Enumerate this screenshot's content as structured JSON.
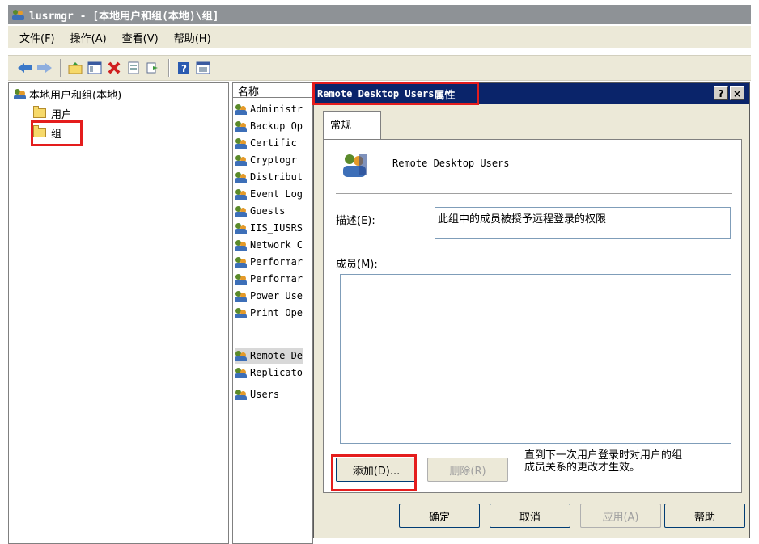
{
  "window": {
    "title": "lusrmgr - [本地用户和组(本地)\\组]",
    "menus": [
      "文件(F)",
      "操作(A)",
      "查看(V)",
      "帮助(H)"
    ],
    "toolbar_icons": [
      "back-icon",
      "forward-icon",
      "up-folder-icon",
      "show-hide-tree-icon",
      "delete-icon",
      "properties-icon",
      "export-icon",
      "help-icon",
      "view-icon"
    ]
  },
  "tree": {
    "root": "本地用户和组(本地)",
    "children": [
      "用户",
      "组"
    ]
  },
  "list": {
    "header": "名称",
    "rows": [
      "Administr",
      "Backup Op",
      "Certific",
      "Cryptogr",
      "Distribut",
      "Event Log",
      "Guests",
      "IIS_IUSRS",
      "Network C",
      "Performar",
      "Performar",
      "Power Use",
      "Print Ope",
      "Remote De",
      "Replicato",
      "Users"
    ]
  },
  "dialog": {
    "title_name": "Remote Desktop Users",
    "title_suffix": " 属性",
    "help_btn": "?",
    "close_btn": "×",
    "tab": "常规",
    "group_name": "Remote Desktop Users",
    "desc_label": "描述(E):",
    "desc_value": "此组中的成员被授予远程登录的权限",
    "members_label": "成员(M):",
    "add_btn": "添加(D)...",
    "remove_btn": "删除(R)",
    "note_line1": "直到下一次用户登录时对用户的组",
    "note_line2": "成员关系的更改才生效。",
    "ok_btn": "确定",
    "cancel_btn": "取消",
    "apply_btn": "应用(A)",
    "help_footer_btn": "帮助"
  },
  "colors": {
    "highlight_red": "#e41d1d",
    "dialog_title_bg": "#0a246a",
    "main_title_bg": "#8e9296"
  }
}
